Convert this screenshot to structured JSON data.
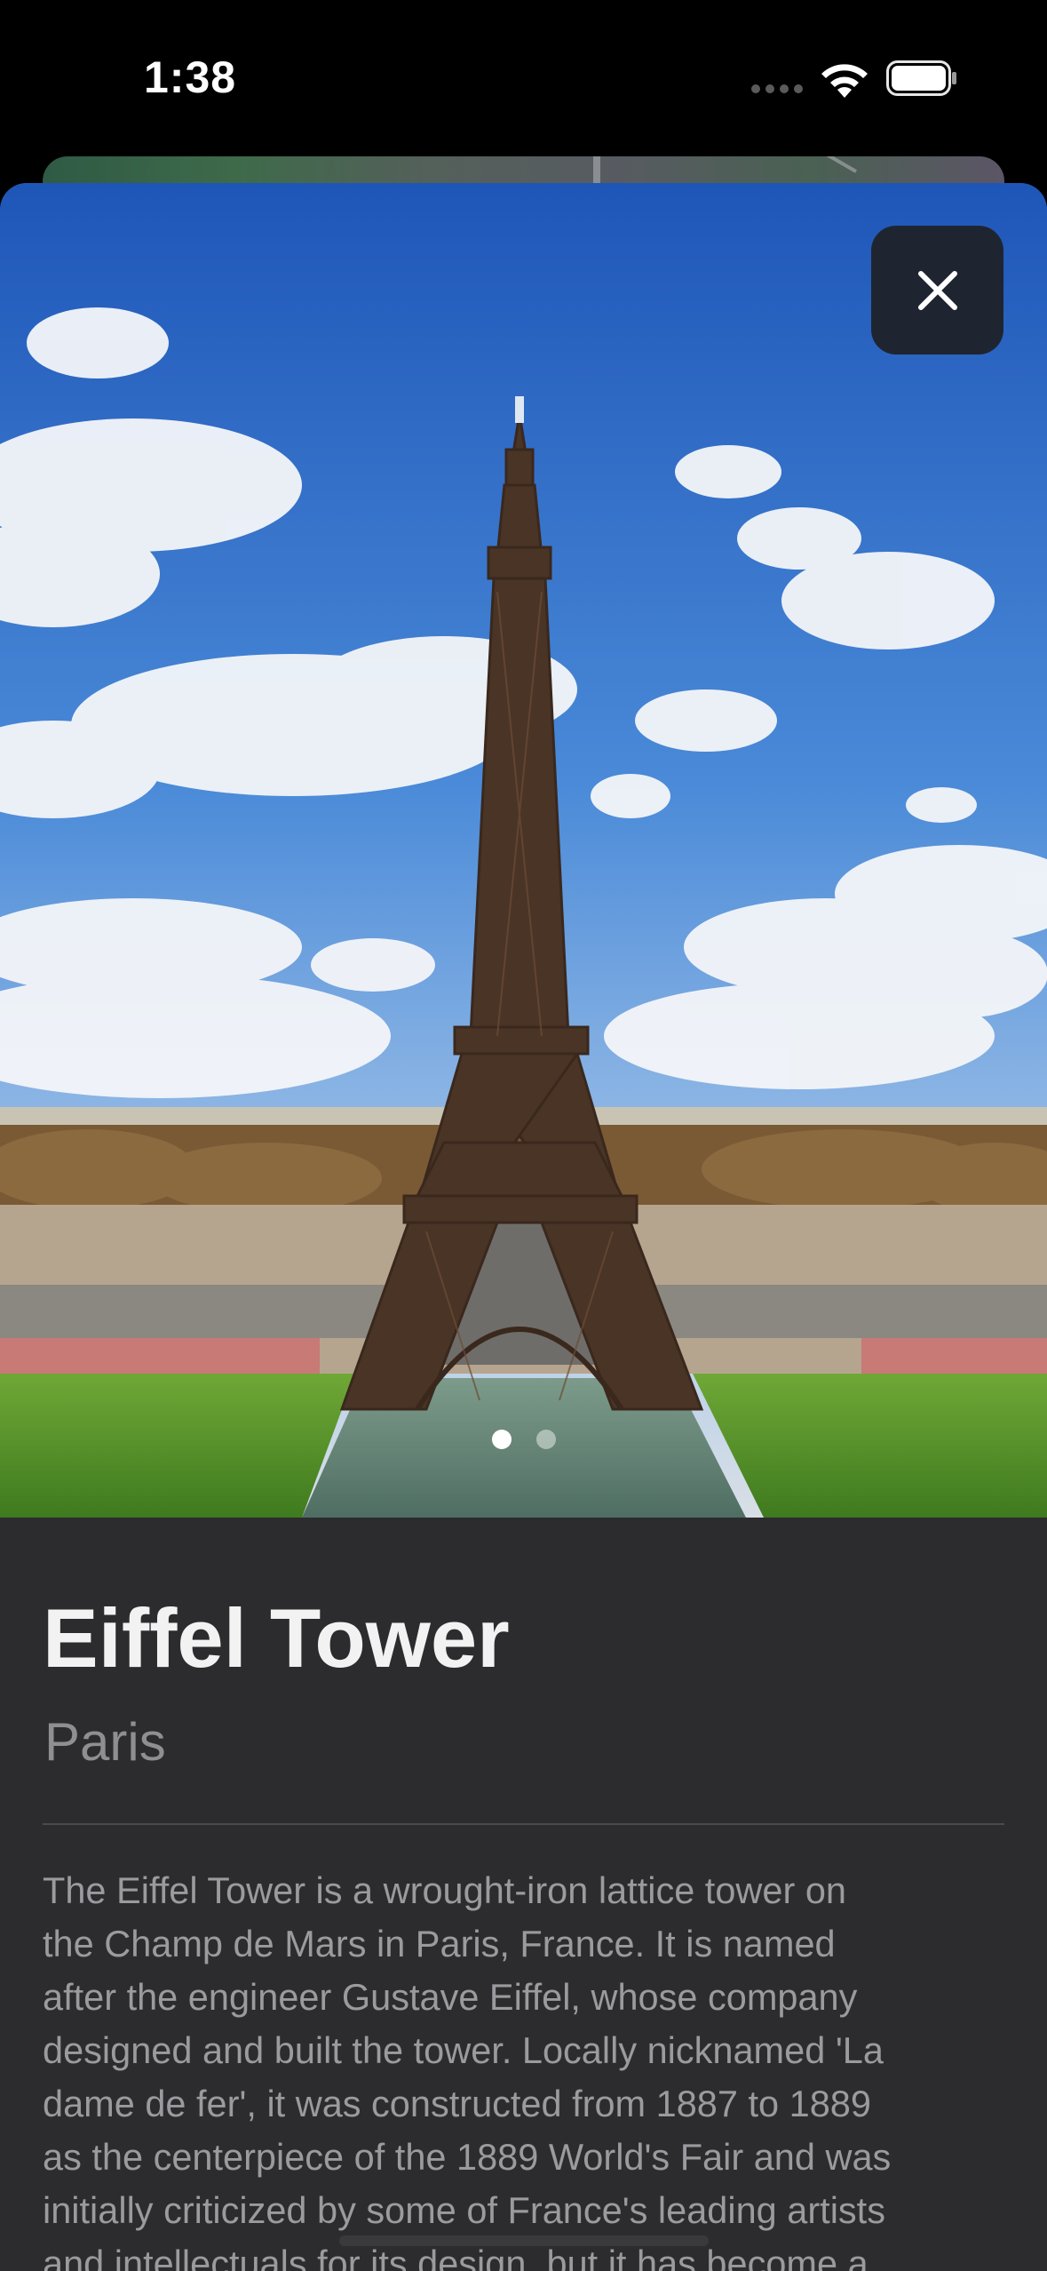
{
  "status_bar": {
    "time": "1:38"
  },
  "place": {
    "title": "Eiffel Tower",
    "city": "Paris",
    "description_lines": [
      "The Eiffel Tower is a wrought-iron lattice tower on",
      "the Champ de Mars in Paris, France. It is named",
      "after the engineer Gustave Eiffel, whose company",
      "designed and built the tower. Locally nicknamed 'La",
      "dame de fer', it was constructed from 1887 to 1889",
      "as the centerpiece of the 1889 World's Fair and was",
      "initially criticized by some of France's leading artists",
      "and intellectuals for its design, but it has become a"
    ]
  },
  "gallery": {
    "page_count": 2,
    "current_page": 1
  },
  "icons": {
    "close": "close-icon",
    "wifi": "wifi-icon",
    "battery": "battery-icon",
    "signal": "cellular-signal-icon"
  }
}
